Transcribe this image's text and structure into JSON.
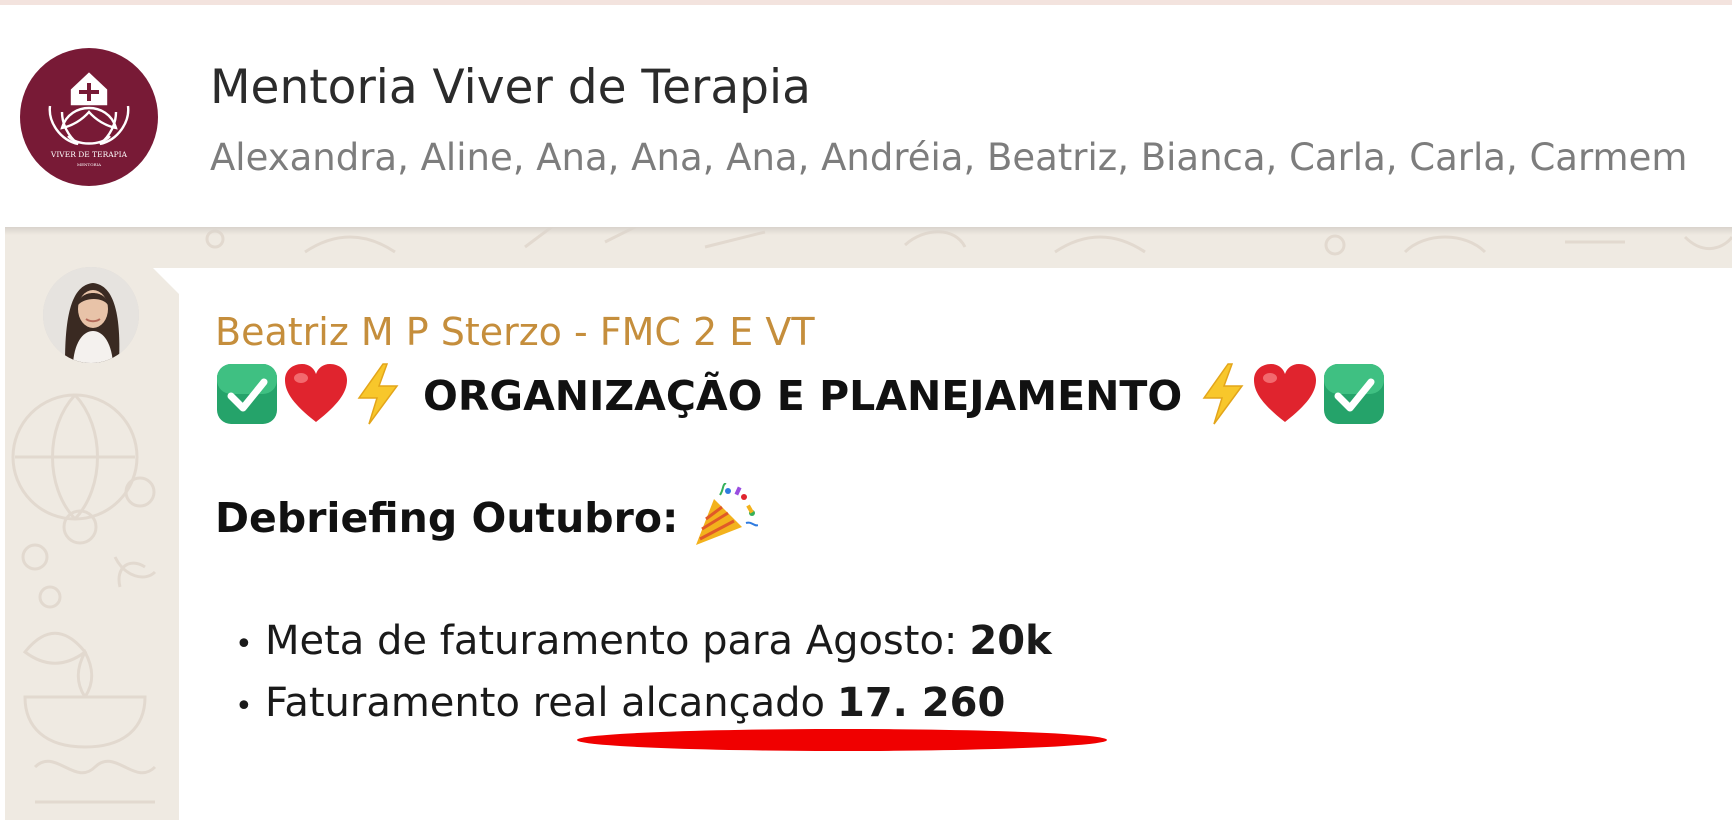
{
  "header": {
    "group_name": "Mentoria Viver de Terapia",
    "members": "Alexandra, Aline, Ana, Ana, Ana, Andréia, Beatriz, Bianca, Carla, Carla, Carmem",
    "avatar_text": "VIVER DE TERAPIA",
    "avatar_subtext": "MENTORIA"
  },
  "message": {
    "sender": "Beatriz M P Sterzo - FMC 2 E VT",
    "headline": "ORGANIZAÇÃO E PLANEJAMENTO",
    "subheading": "Debriefing Outubro:",
    "bullets": [
      {
        "bullet": "•",
        "label": "Meta de faturamento para Agosto:",
        "value": "20k"
      },
      {
        "bullet": "•",
        "label": "Faturamento real alcançado",
        "value": "17. 260"
      }
    ],
    "icons": [
      "check-mark-button-icon",
      "red-heart-icon",
      "high-voltage-icon",
      "party-popper-icon"
    ]
  },
  "colors": {
    "avatar_bg": "#781a36",
    "sender_name": "#c58e3c",
    "chat_bg": "#efeae2",
    "highlight": "#f00000"
  }
}
